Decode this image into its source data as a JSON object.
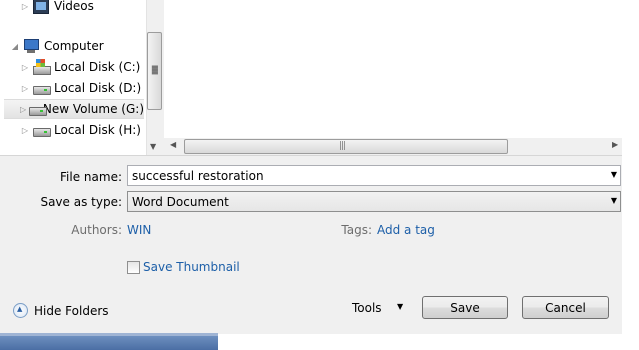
{
  "nav_tree": {
    "items": [
      {
        "label": "Videos",
        "icon": "video-icon"
      },
      {
        "label": "Computer",
        "icon": "computer-icon"
      },
      {
        "label": "Local Disk (C:)",
        "icon": "windows-drive-icon"
      },
      {
        "label": "Local Disk (D:)",
        "icon": "drive-icon"
      },
      {
        "label": "New Volume (G:)",
        "icon": "drive-icon",
        "selected": true
      },
      {
        "label": "Local Disk (H:)",
        "icon": "drive-icon"
      }
    ]
  },
  "form": {
    "file_name_label": "File name:",
    "file_name_value": "successful restoration",
    "save_as_type_label": "Save as type:",
    "save_as_type_value": "Word Document",
    "authors_label": "Authors:",
    "authors_value": "WIN",
    "tags_label": "Tags:",
    "tags_value": "Add a tag",
    "save_thumbnail_label": "Save Thumbnail",
    "save_thumbnail_checked": false
  },
  "footer": {
    "hide_folders_label": "Hide Folders",
    "tools_label": "Tools",
    "save_label": "Save",
    "cancel_label": "Cancel"
  },
  "colors": {
    "dialog_bg": "#f0f0f0",
    "link": "#1d5fa8",
    "dim_label": "#6d6d6d"
  }
}
